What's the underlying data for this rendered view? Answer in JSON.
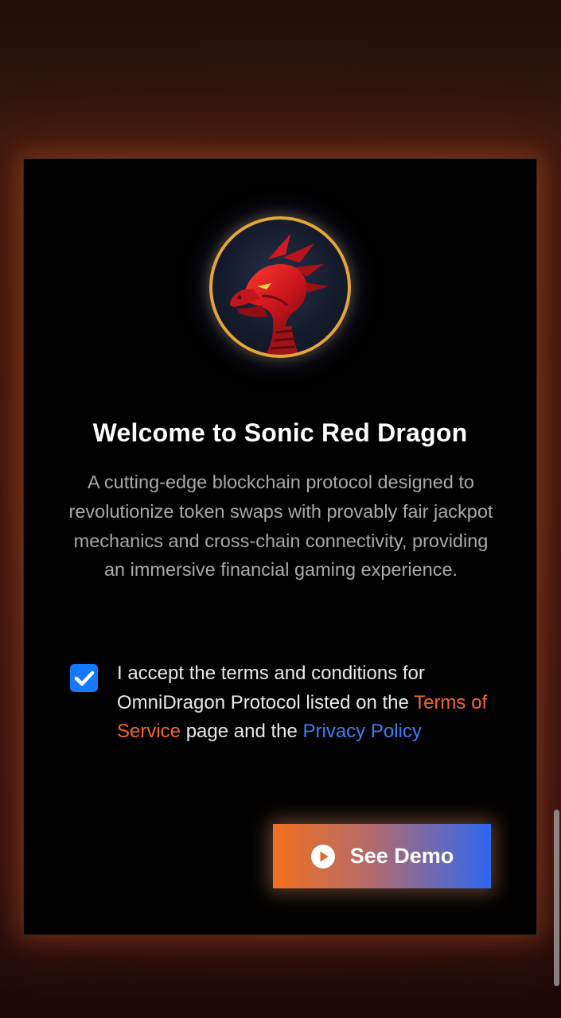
{
  "modal": {
    "logo": {
      "icon": "red-dragon-logo",
      "border_color": "#e2a63a"
    },
    "title": "Welcome to Sonic Red Dragon",
    "description": "A cutting-edge blockchain protocol designed to revolutionize token swaps with provably fair jackpot mechanics and cross-chain connectivity, providing an immersive financial gaming experience.",
    "terms": {
      "checked": true,
      "text_before": "I accept the terms and conditions for OmniDragon Protocol listed on the ",
      "tos_link": "Terms of Service",
      "text_middle": " page and the ",
      "privacy_link": "Privacy Policy"
    },
    "demo_button": {
      "label": "See Demo",
      "icon": "play-circle-icon"
    }
  },
  "colors": {
    "accent_orange": "#f3662c",
    "accent_blue": "#3d7ef6",
    "checkbox": "#1479ff"
  }
}
